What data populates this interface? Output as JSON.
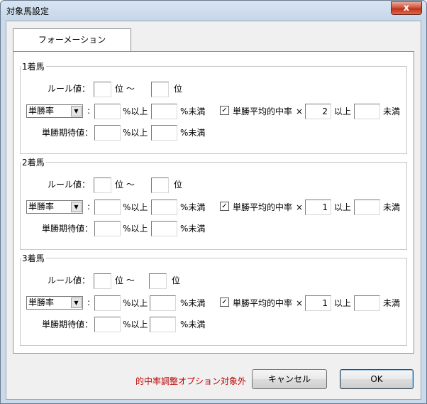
{
  "window": {
    "title": "対象馬設定",
    "close_label": "x"
  },
  "tabs": [
    {
      "label": "フォーメーション"
    }
  ],
  "labels": {
    "rule_value": "ルール値：",
    "rank_from": "位 〜",
    "rank_to": "位",
    "colon": ":",
    "pct_over": "%以上",
    "pct_under": "%未満",
    "expected_value": "単勝期待値：",
    "avg_hit_rate": "単勝平均的中率",
    "times": "×",
    "over": "以上",
    "under": "未満"
  },
  "sections": [
    {
      "title": "1着馬",
      "select_value": "単勝率",
      "checked": true,
      "multiplier": "2",
      "check_glyph": "✓"
    },
    {
      "title": "2着馬",
      "select_value": "単勝率",
      "checked": true,
      "multiplier": "1",
      "check_glyph": "✓"
    },
    {
      "title": "3着馬",
      "select_value": "単勝率",
      "checked": true,
      "multiplier": "1",
      "check_glyph": "✓"
    }
  ],
  "footer": {
    "note": "的中率調整オプション対象外",
    "cancel_label": "キャンセル",
    "ok_label": "OK"
  },
  "icons": {
    "dropdown": "chevron-down-icon",
    "check": "check-icon"
  }
}
